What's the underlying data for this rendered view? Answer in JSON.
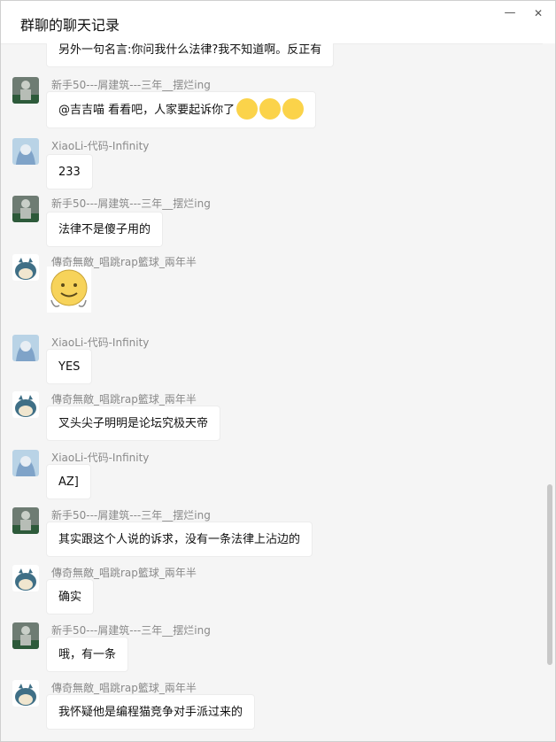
{
  "window": {
    "title": "群聊的聊天记录",
    "minimize_label": "—",
    "close_label": "✕"
  },
  "users": {
    "newbie": {
      "name": "新手50---屑建筑---三年__摆烂ing"
    },
    "xiaoli": {
      "name": "XiaoLi-代码-Infinity"
    },
    "legend": {
      "name": "傳奇無敵_唱跳rap籃球_兩年半"
    }
  },
  "messages": [
    {
      "text": "另外一句名言:你问我什么法律?我不知道啊。反正有"
    },
    {
      "sender": "新手50---屑建筑---三年__摆烂ing",
      "text": "@吉吉喵 看看吧，人家要起诉你了",
      "emoji_count": 3
    },
    {
      "sender": "XiaoLi-代码-Infinity",
      "text": "233"
    },
    {
      "sender": "新手50---屑建筑---三年__摆烂ing",
      "text": "法律不是傻子用的"
    },
    {
      "sender": "傳奇無敵_唱跳rap籃球_兩年半",
      "sticker": "smiling-face-sticker"
    },
    {
      "sender": "XiaoLi-代码-Infinity",
      "text": "YES"
    },
    {
      "sender": "傳奇無敵_唱跳rap籃球_兩年半",
      "text": "叉头尖子明明是论坛究极天帝"
    },
    {
      "sender": "XiaoLi-代码-Infinity",
      "text": "AZ]"
    },
    {
      "sender": "新手50---屑建筑---三年__摆烂ing",
      "text": "其实跟这个人说的诉求，没有一条法律上沾边的"
    },
    {
      "sender": "傳奇無敵_唱跳rap籃球_兩年半",
      "text": "确实"
    },
    {
      "sender": "新手50---屑建筑---三年__摆烂ing",
      "text": "哦，有一条"
    },
    {
      "sender": "傳奇無敵_唱跳rap籃球_兩年半",
      "text": "我怀疑他是编程猫竞争对手派过来的"
    }
  ],
  "colors": {
    "sender_name": "#8a8a8a",
    "bubble_bg": "#ffffff",
    "chat_bg": "#f5f5f5",
    "emoji": "#fbd34a"
  }
}
